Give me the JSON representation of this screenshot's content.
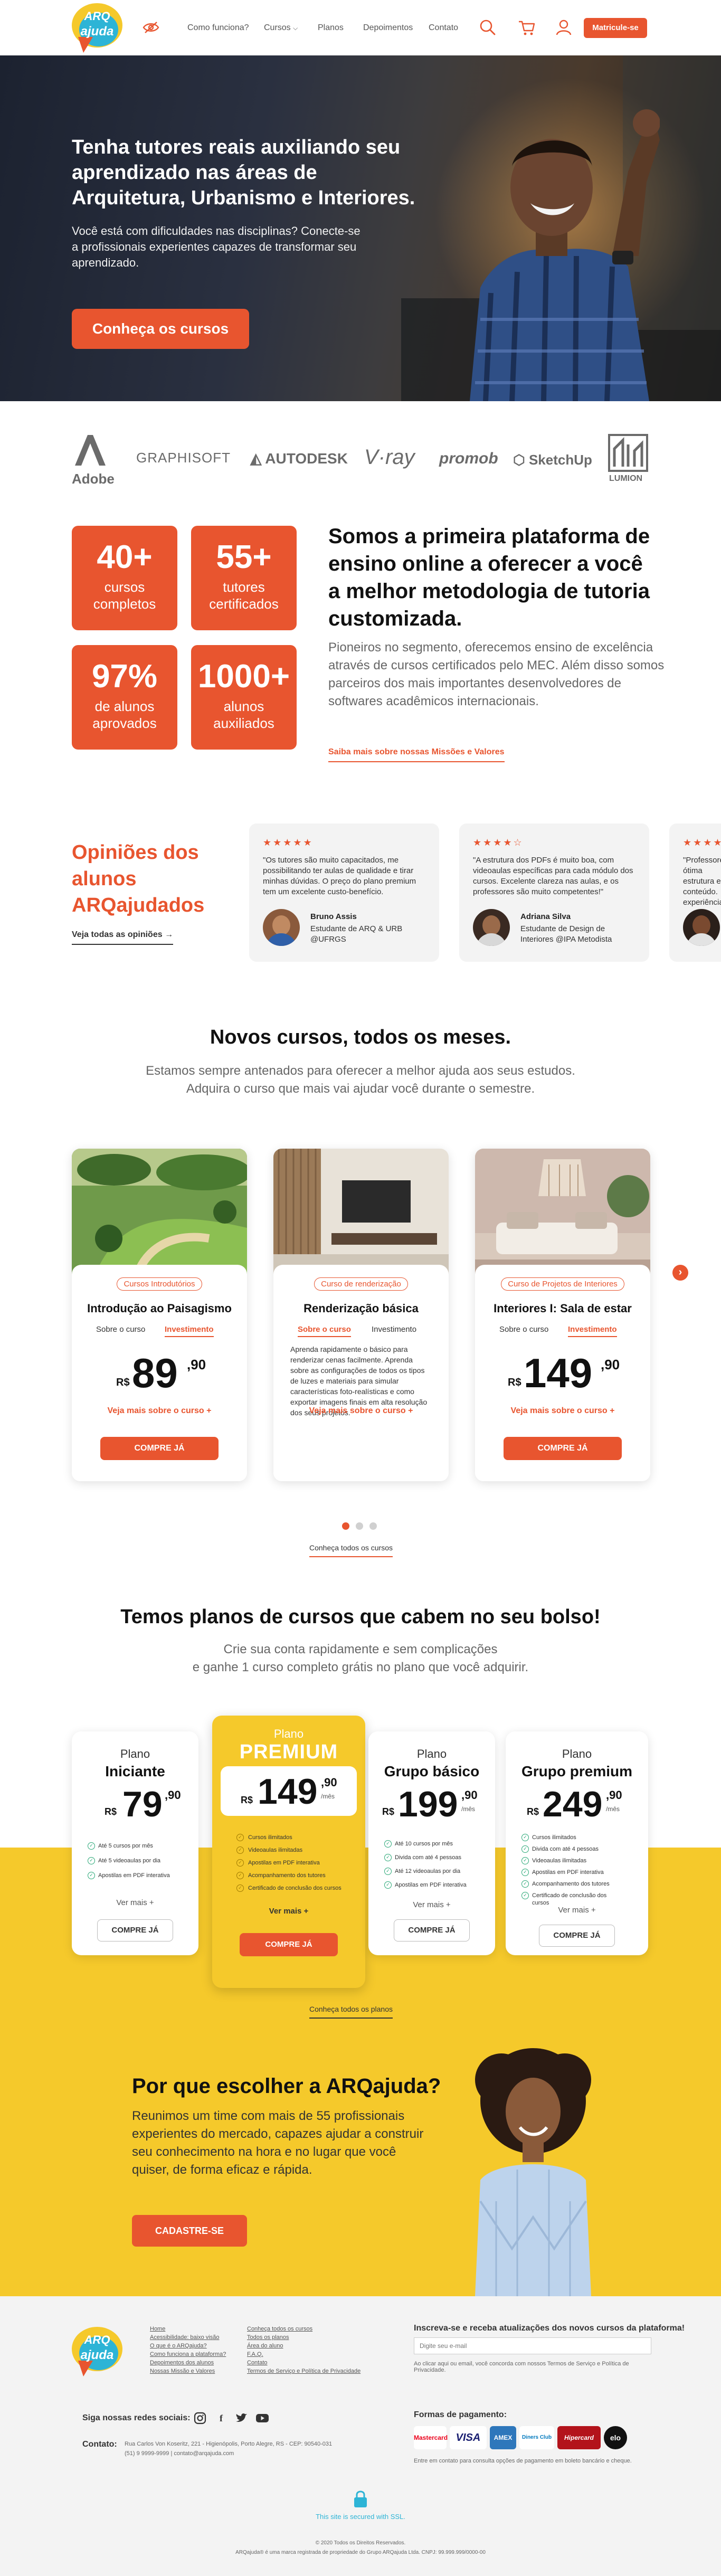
{
  "header": {
    "logo_top": "ARQ",
    "logo_bottom": "ajuda",
    "nav": [
      "Como funciona?",
      "Cursos",
      "Planos",
      "Depoimentos",
      "Contato"
    ],
    "cta": "Matricule-se"
  },
  "hero": {
    "title": "Tenha tutores reais auxiliando seu aprendizado nas áreas de Arquitetura, Urbanismo e Interiores.",
    "text": "Você está com dificuldades nas disciplinas? Conecte-se a profissionais experientes capazes de transformar seu aprendizado.",
    "cta": "Conheça os cursos"
  },
  "partners": [
    "Adobe",
    "GRAPHISOFT",
    "AUTODESK",
    "V·ray",
    "promob",
    "SketchUp",
    "LUMION"
  ],
  "stats": [
    {
      "num": "40+",
      "label": "cursos completos"
    },
    {
      "num": "55+",
      "label": "tutores certificados"
    },
    {
      "num": "97%",
      "label": "de alunos aprovados"
    },
    {
      "num": "1000+",
      "label": "alunos auxiliados"
    }
  ],
  "about": {
    "title": "Somos a primeira plataforma de ensino online a oferecer a você a melhor metodologia de tutoria customizada.",
    "text": "Pioneiros no segmento, oferecemos ensino de excelência através de cursos certificados pelo MEC. Além disso somos parceiros dos mais importantes desenvolvedores de softwares acadêmicos internacionais.",
    "link": "Saiba mais sobre nossas Missões e Valores"
  },
  "testimonials": {
    "title": "Opiniões dos alunos ARQajudados",
    "link": "Veja todas as opiniões →",
    "items": [
      {
        "stars": "★★★★★",
        "quote": "\"Os tutores são muito capacitados, me possibilitando ter aulas de qualidade e tirar minhas dúvidas. O preço do plano premium tem um excelente custo-benefício.",
        "name": "Bruno Assis",
        "role": "Estudante de ARQ & URB @UFRGS"
      },
      {
        "stars": "★★★★☆",
        "quote": "\"A estrutura dos PDFs é muito boa, com videoaulas específicas para cada módulo dos cursos. Excelente clareza nas aulas, e os professores são muito competentes!\"",
        "name": "Adriana Silva",
        "role": "Estudante de Design de Interiores @IPA Metodista"
      },
      {
        "stars": "★★★★★",
        "quote": "\"Professores ótima estrutura e conteúdo. experiência"
      }
    ]
  },
  "courses": {
    "title": "Novos cursos, todos os meses.",
    "subtitle_1": "Estamos sempre antenados para oferecer a melhor ajuda aos seus estudos.",
    "subtitle_2": "Adquira o curso que mais vai ajudar você durante o semestre.",
    "tab_about": "Sobre o curso",
    "tab_invest": "Investimento",
    "currency": "R$",
    "more": "Veja mais sobre o curso +",
    "buy": "COMPRE JÁ",
    "all_link": "Conheça todos os cursos",
    "items": [
      {
        "category": "Cursos Introdutórios",
        "title": "Introdução ao Paisagismo",
        "price": "89",
        "cents": ",90"
      },
      {
        "category": "Curso de renderização",
        "title": "Renderização básica",
        "desc": "Aprenda rapidamente o básico para renderizar cenas facilmente. Aprenda sobre as configurações de todos os tipos de luzes e materiais para simular características foto-realísticas e como exportar imagens finais em alta resolução dos seus projetos."
      },
      {
        "category": "Curso de Projetos de Interiores",
        "title": "Interiores I: Sala de estar",
        "price": "149",
        "cents": ",90"
      }
    ]
  },
  "plans": {
    "title": "Temos planos de cursos que cabem no seu bolso!",
    "subtitle_1": "Crie sua conta rapidamente e sem complicações",
    "subtitle_2": "e ganhe 1 curso completo grátis no plano que você adquirir.",
    "plan_word": "Plano",
    "currency": "R$",
    "per_month": "/mês",
    "more": "Ver mais +",
    "buy": "COMPRE JÁ",
    "all_link": "Conheça todos os planos",
    "items": [
      {
        "name": "Iniciante",
        "price": "79",
        "cents": ",90",
        "features": [
          "Até 5 cursos por mês",
          "Até 5 videoaulas por dia",
          "Apostilas em PDF interativa"
        ]
      },
      {
        "name": "PREMIUM",
        "price": "149",
        "cents": ",90",
        "features": [
          "Cursos ilimitados",
          "Videoaulas ilimitadas",
          "Apostilas em PDF interativa",
          "Acompanhamento dos tutores",
          "Certificado de conclusão dos cursos"
        ]
      },
      {
        "name": "Grupo básico",
        "price": "199",
        "cents": ",90",
        "features": [
          "Até 10 cursos por mês",
          "Divida com até 4 pessoas",
          "Até 12 videoaulas por dia",
          "Apostilas em PDF interativa"
        ]
      },
      {
        "name": "Grupo premium",
        "price": "249",
        "cents": ",90",
        "features": [
          "Cursos ilimitados",
          "Divida com até 4 pessoas",
          "Videoaulas ilimitadas",
          "Apostilas em PDF interativa",
          "Acompanhamento dos tutores",
          "Certificado de conclusão dos cursos"
        ]
      }
    ]
  },
  "why": {
    "title": "Por que escolher a ARQajuda?",
    "text": "Reunimos um time com mais de 55 profissionais experientes do mercado, capazes ajudar a construir seu conhecimento na hora e no lugar que você quiser, de forma eficaz e rápida.",
    "cta": "CADASTRE-SE"
  },
  "footer": {
    "links_col1": [
      "Home",
      "Acessibilidade: baixo visão",
      "O que é o ARQajuda?",
      "Como funciona a plataforma?",
      "Depoimentos dos alunos",
      "Nossas Missão e Valores"
    ],
    "links_col2": [
      "Conheça todos os cursos",
      "Todos os planos",
      "Área do aluno",
      "F.A.Q.",
      "Contato",
      "Termos de Serviço e Política de Privacidade"
    ],
    "newsletter_title": "Inscreva-se e receba atualizações dos novos cursos da plataforma!",
    "newsletter_placeholder": "Digite seu e-mail",
    "newsletter_note": "Ao clicar aqui ou email, você concorda com nossos Termos de Serviço e Política de Privacidade.",
    "social_label": "Siga nossas redes sociais:",
    "contact_label": "Contato:",
    "contact_address": "Rua Carlos Von Koseritz, 221 - Higienópolis, Porto Alegre, RS - CEP: 90540-031",
    "contact_phone": "(51) 9 9999-9999 | contato@arqajuda.com",
    "payment_label": "Formas de pagamento:",
    "payments": [
      "Mastercard",
      "VISA",
      "AMEX",
      "Diners Club",
      "Hipercard",
      "elo"
    ],
    "payment_note": "Entre em contato para consulta opções de pagamento em boleto bancário e cheque.",
    "ssl": "This site is secured with SSL.",
    "copyright": "© 2020 Todos os Direitos Reservados.",
    "legal": "ARQajuda® é uma marca registrada de propriedade do Grupo ARQajuda Ltda. CNPJ: 99.999.999/0000-00"
  }
}
